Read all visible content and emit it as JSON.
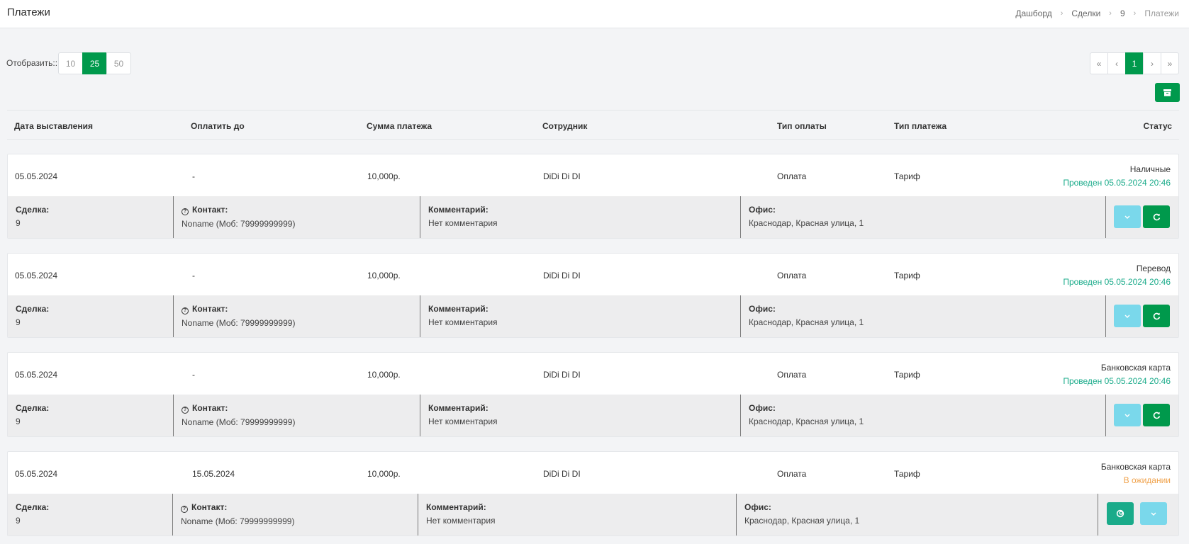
{
  "header": {
    "title": "Платежи",
    "breadcrumb": [
      "Дашборд",
      "Сделки",
      "9",
      "Платежи"
    ]
  },
  "per_page": {
    "label": "Отобразить::",
    "options": [
      "10",
      "25",
      "50"
    ],
    "selected": "25"
  },
  "pagination": {
    "first": "«",
    "prev": "‹",
    "current": "1",
    "next": "›",
    "last": "»"
  },
  "archive_button": {
    "icon": "archive-icon"
  },
  "table": {
    "columns": [
      "Дата выставления",
      "Оплатить до",
      "Сумма платежа",
      "Сотрудник",
      "Тип оплаты",
      "Тип платежа",
      "Статус"
    ],
    "rows": [
      {
        "date": "05.05.2024",
        "due": "-",
        "amount": "10,000р.",
        "employee": "DiDi Di DI",
        "pay_type": "Оплата",
        "payment_type": "Тариф",
        "method": "Наличные",
        "status": "Проведен 05.05.2024 20:46",
        "status_kind": "ok",
        "deal_label": "Сделка:",
        "deal": "9",
        "contact_label": "Контакт:",
        "contact": "Noname (Моб: 79999999999)",
        "comment_label": "Комментарий:",
        "comment": "Нет комментария",
        "office_label": "Офис:",
        "office": "Краснодар, Красная улица, 1"
      },
      {
        "date": "05.05.2024",
        "due": "-",
        "amount": "10,000р.",
        "employee": "DiDi Di DI",
        "pay_type": "Оплата",
        "payment_type": "Тариф",
        "method": "Перевод",
        "status": "Проведен 05.05.2024 20:46",
        "status_kind": "ok",
        "deal_label": "Сделка:",
        "deal": "9",
        "contact_label": "Контакт:",
        "contact": "Noname (Моб: 79999999999)",
        "comment_label": "Комментарий:",
        "comment": "Нет комментария",
        "office_label": "Офис:",
        "office": "Краснодар, Красная улица, 1"
      },
      {
        "date": "05.05.2024",
        "due": "-",
        "amount": "10,000р.",
        "employee": "DiDi Di DI",
        "pay_type": "Оплата",
        "payment_type": "Тариф",
        "method": "Банковская карта",
        "status": "Проведен 05.05.2024 20:46",
        "status_kind": "ok",
        "deal_label": "Сделка:",
        "deal": "9",
        "contact_label": "Контакт:",
        "contact": "Noname (Моб: 79999999999)",
        "comment_label": "Комментарий:",
        "comment": "Нет комментария",
        "office_label": "Офис:",
        "office": "Краснодар, Красная улица, 1"
      },
      {
        "date": "05.05.2024",
        "due": "15.05.2024",
        "amount": "10,000р.",
        "employee": "DiDi Di DI",
        "pay_type": "Оплата",
        "payment_type": "Тариф",
        "method": "Банковская карта",
        "status": "В ожидании",
        "status_kind": "wait",
        "deal_label": "Сделка:",
        "deal": "9",
        "contact_label": "Контакт:",
        "contact": "Noname (Моб: 79999999999)",
        "comment_label": "Комментарий:",
        "comment": "Нет комментария",
        "office_label": "Офис:",
        "office": "Краснодар, Красная улица, 1"
      }
    ]
  },
  "colors": {
    "accent": "#00994c",
    "status_ok": "#1aab8a",
    "status_wait": "#f0a24b",
    "info_button": "#7ad8eb"
  }
}
